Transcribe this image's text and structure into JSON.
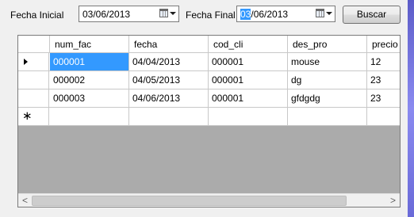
{
  "form": {
    "fecha_inicial_label": "Fecha Inicial",
    "fecha_inicial_value": "03/06/2013",
    "fecha_final_label": "Fecha Final",
    "fecha_final_day": "03",
    "fecha_final_rest": "/06/2013",
    "buscar_label": "Buscar"
  },
  "grid": {
    "columns": [
      "num_fac",
      "fecha",
      "cod_cli",
      "des_pro",
      "precio"
    ],
    "rows": [
      [
        "000001",
        "04/04/2013",
        "000001",
        "mouse",
        "12"
      ],
      [
        "000002",
        "04/05/2013",
        "000001",
        "dg",
        "23"
      ],
      [
        "000003",
        "04/06/2013",
        "000001",
        "gfdgdg",
        "23"
      ]
    ],
    "new_row_marker": "∗"
  },
  "scrollbar": {
    "left_arrow": "<",
    "right_arrow": ">"
  },
  "colors": {
    "selection": "#3399ff",
    "grid_empty_area": "#ababab"
  }
}
